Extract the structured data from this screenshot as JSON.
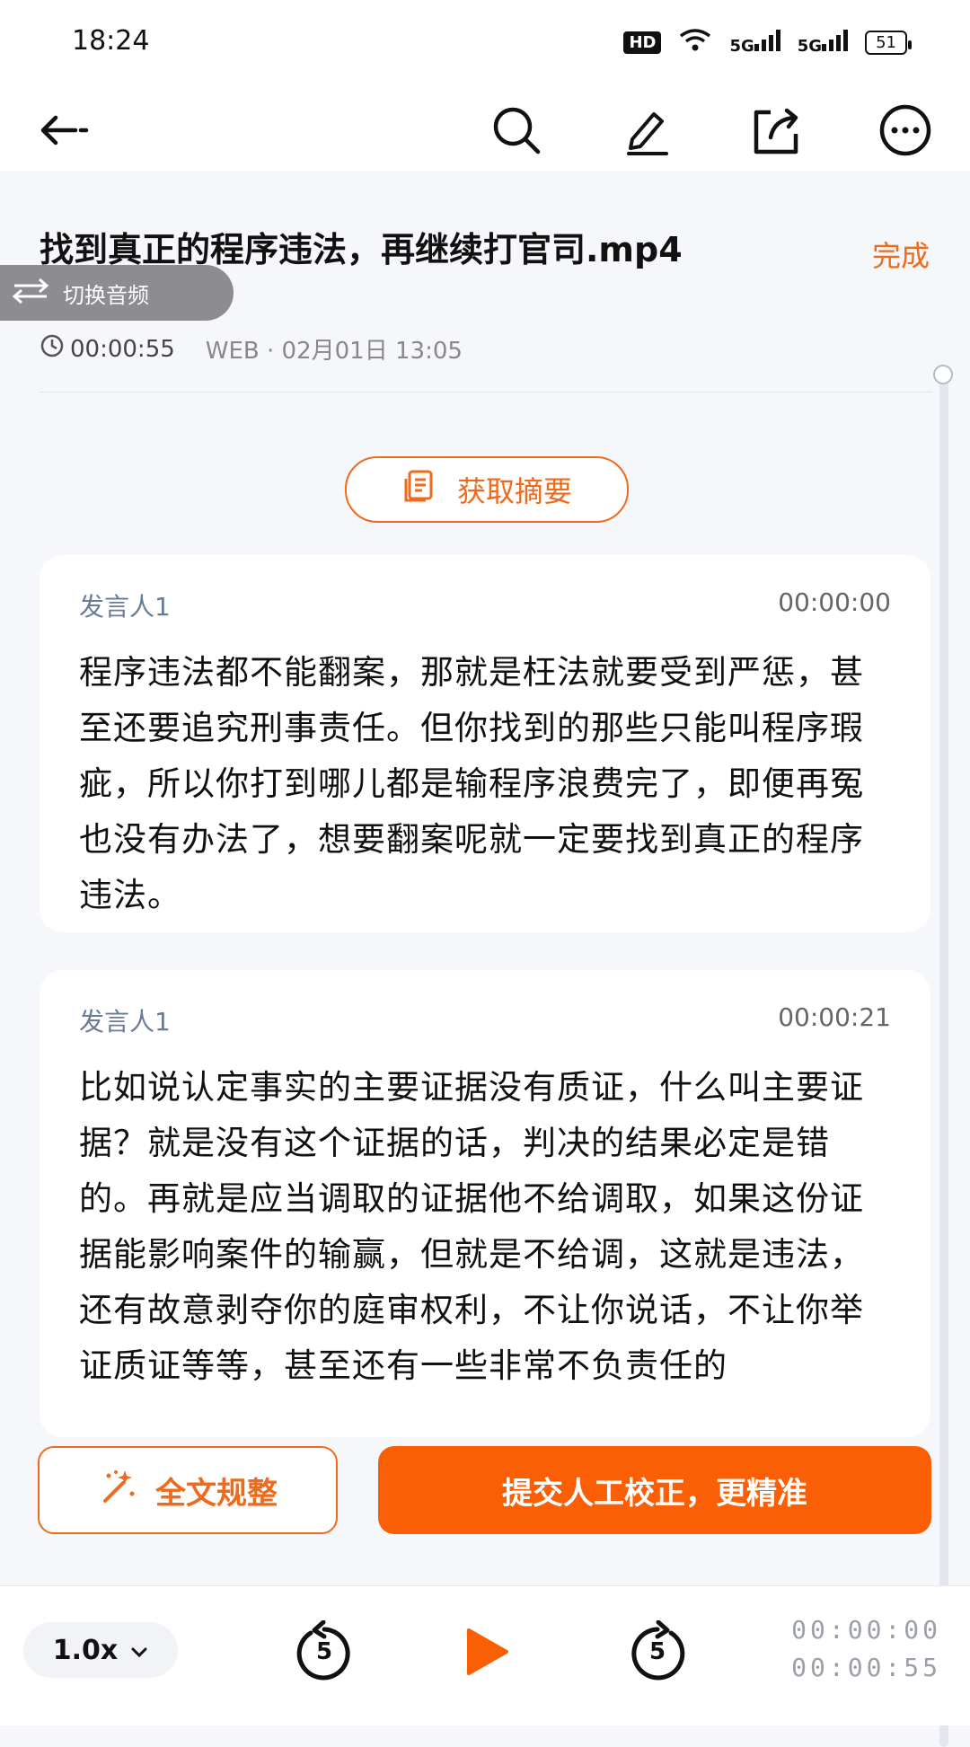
{
  "status": {
    "time": "18:24",
    "hd": "HD",
    "net1": "5G",
    "net2": "5G",
    "battery": "51"
  },
  "toolbar": {
    "back_icon": "back-arrow-icon",
    "search_icon": "search-icon",
    "edit_icon": "edit-icon",
    "share_icon": "share-icon",
    "more_icon": "more-icon"
  },
  "header": {
    "title": "找到真正的程序违法，再继续打官司.mp4",
    "done": "完成",
    "switch_audio": "切换音频",
    "duration": "00:00:55",
    "source": "WEB · 02月01日 13:05"
  },
  "summary_button": "获取摘要",
  "transcript": [
    {
      "speaker": "发言人1",
      "time": "00:00:00",
      "text": "程序违法都不能翻案，那就是枉法就要受到严惩，甚至还要追究刑事责任。但你找到的那些只能叫程序瑕疵，所以你打到哪儿都是输程序浪费完了，即便再冤也没有办法了，想要翻案呢就一定要找到真正的程序违法。"
    },
    {
      "speaker": "发言人1",
      "time": "00:00:21",
      "text": "比如说认定事实的主要证据没有质证，什么叫主要证据？就是没有这个证据的话，判决的结果必定是错的。再就是应当调取的证据他不给调取，如果这份证据能影响案件的输赢，但就是不给调，这就是违法，还有故意剥夺你的庭审权利，不让你说话，不让你举证质证等等，甚至还有一些非常不负责任的"
    }
  ],
  "actions": {
    "format_all": "全文规整",
    "submit_correction": "提交人工校正，更精准"
  },
  "player": {
    "speed": "1.0x",
    "rewind_seconds": "5",
    "forward_seconds": "5",
    "current_time": "00:00:00",
    "total_time": "00:00:55"
  },
  "colors": {
    "accent": "#fb5f06",
    "accent_text": "#f06a1b",
    "speaker": "#6a7b96"
  }
}
